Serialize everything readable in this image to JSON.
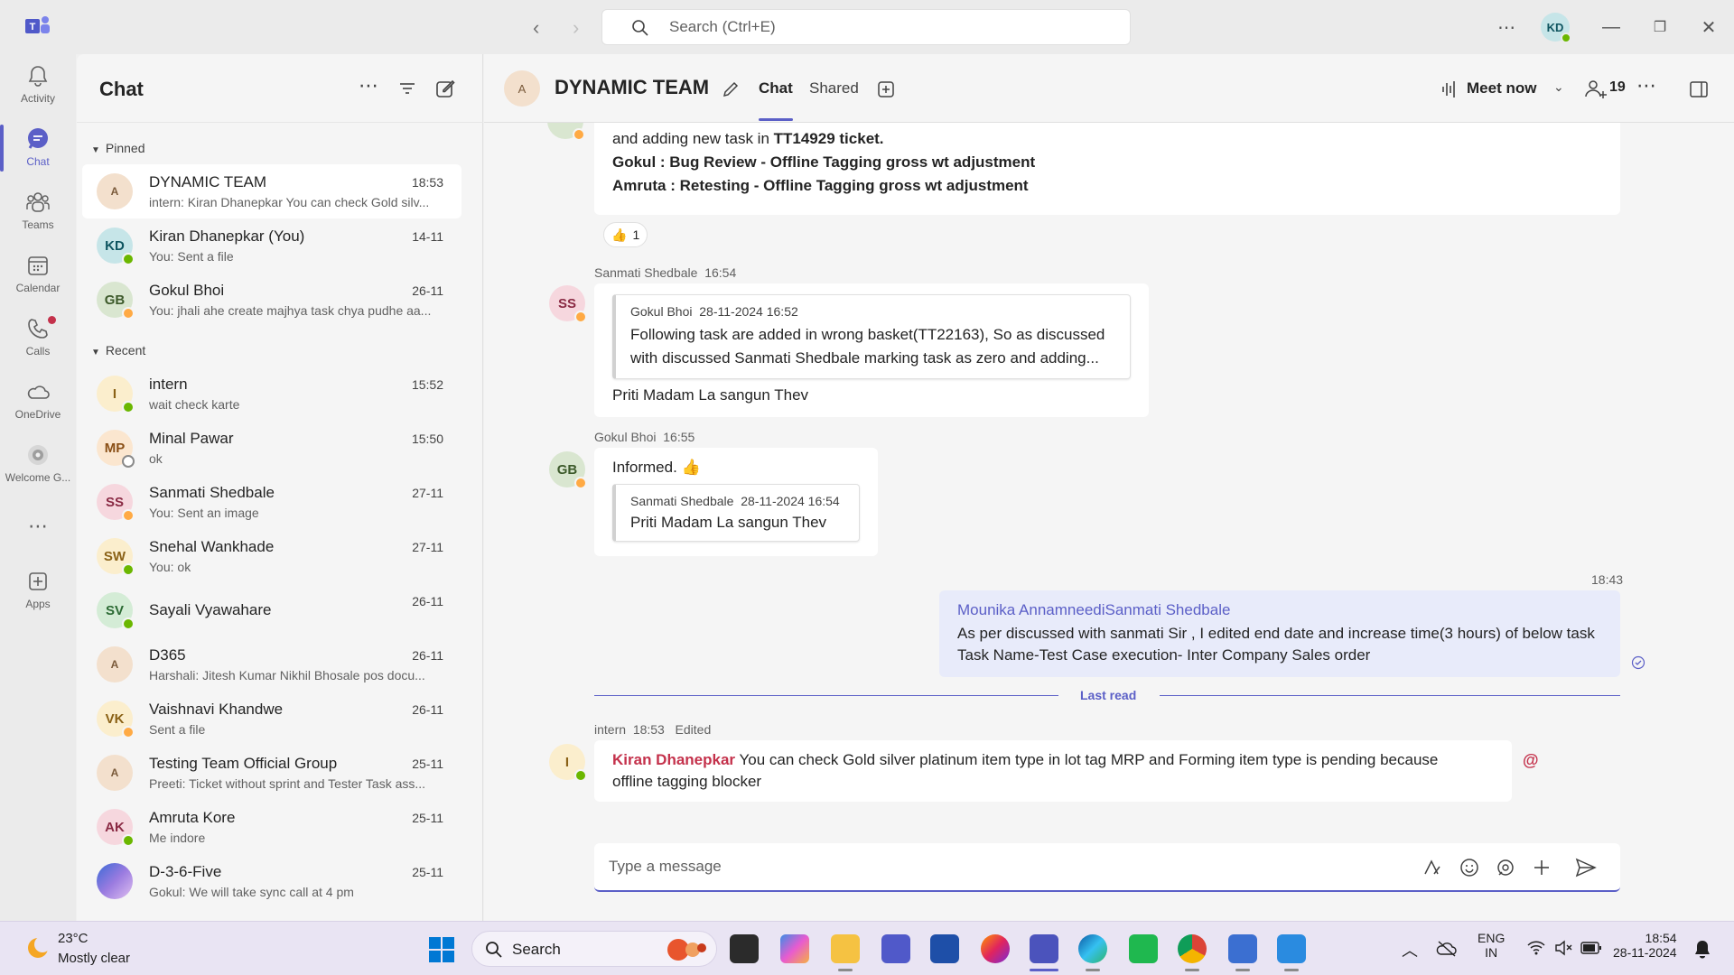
{
  "titlebar": {
    "search_placeholder": "Search (Ctrl+E)",
    "user_initials": "KD"
  },
  "rail": {
    "items": [
      {
        "label": "Activity",
        "icon": "bell-icon"
      },
      {
        "label": "Chat",
        "icon": "chat-icon",
        "active": true
      },
      {
        "label": "Teams",
        "icon": "teams-icon"
      },
      {
        "label": "Calendar",
        "icon": "calendar-icon"
      },
      {
        "label": "Calls",
        "icon": "phone-icon"
      },
      {
        "label": "OneDrive",
        "icon": "cloud-icon"
      },
      {
        "label": "Welcome G...",
        "icon": "welcome-icon"
      },
      {
        "label": "Apps",
        "icon": "apps-icon"
      }
    ]
  },
  "chatlist": {
    "title": "Chat",
    "pinned_label": "Pinned",
    "recent_label": "Recent",
    "pinned": [
      {
        "name": "DYNAMIC TEAM",
        "time": "18:53",
        "preview": "intern: Kiran Dhanepkar You can check Gold silv...",
        "initials": "A",
        "type": "group"
      },
      {
        "name": "Kiran Dhanepkar (You)",
        "time": "14-11",
        "preview": "You: Sent a file",
        "initials": "KD",
        "presence": "green"
      },
      {
        "name": "Gokul Bhoi",
        "time": "26-11",
        "preview": "You: jhali ahe create majhya task chya pudhe aa...",
        "initials": "GB",
        "presence": "yellow"
      }
    ],
    "recent": [
      {
        "name": "intern",
        "time": "15:52",
        "preview": "wait check karte",
        "initials": "I",
        "presence": "green"
      },
      {
        "name": "Minal Pawar",
        "time": "15:50",
        "preview": "ok",
        "initials": "MP",
        "presence": "offline"
      },
      {
        "name": "Sanmati Shedbale",
        "time": "27-11",
        "preview": "You: Sent an image",
        "initials": "SS",
        "presence": "yellow"
      },
      {
        "name": "Snehal Wankhade",
        "time": "27-11",
        "preview": "You: ok",
        "initials": "SW",
        "presence": "green"
      },
      {
        "name": "Sayali Vyawahare",
        "time": "26-11",
        "preview": "",
        "initials": "SV",
        "presence": "green"
      },
      {
        "name": "D365",
        "time": "26-11",
        "preview": "Harshali: Jitesh Kumar Nikhil Bhosale pos docu...",
        "initials": "A",
        "type": "group"
      },
      {
        "name": "Vaishnavi Khandwe",
        "time": "26-11",
        "preview": "Sent a file",
        "initials": "VK",
        "presence": "yellow"
      },
      {
        "name": "Testing Team Official Group",
        "time": "25-11",
        "preview": "Preeti: Ticket without sprint and Tester Task ass...",
        "initials": "A",
        "type": "group"
      },
      {
        "name": "Amruta Kore",
        "time": "25-11",
        "preview": "Me indore",
        "initials": "AK",
        "presence": "green"
      },
      {
        "name": "D-3-6-Five",
        "time": "25-11",
        "preview": "Gokul: We will take sync call at 4 pm",
        "initials": "",
        "type": "image"
      }
    ]
  },
  "header": {
    "team_name": "DYNAMIC TEAM",
    "team_initials": "A",
    "tabs": [
      "Chat",
      "Shared"
    ],
    "meet_now": "Meet now",
    "participant_count": "19"
  },
  "messages": {
    "m1": {
      "line1_pre": "and adding new task in ",
      "line1_bold": "TT14929",
      "line1_post": " ticket.",
      "line2": "Gokul : Bug Review - Offline Tagging gross wt adjustment",
      "line3": "Amruta : Retesting - Offline Tagging gross wt adjustment",
      "reaction_emoji": "👍",
      "reaction_count": "1"
    },
    "m2": {
      "sender": "Sanmati Shedbale",
      "time": "16:54",
      "initials": "SS",
      "quote_author": "Gokul Bhoi",
      "quote_time": "28-11-2024 16:52",
      "quote_line1": "Following task are added in wrong basket(TT22163), So as discussed",
      "quote_line2": "with discussed Sanmati Shedbale marking task as zero and adding...",
      "text": "Priti Madam La sangun Thev"
    },
    "m3": {
      "sender": "Gokul Bhoi",
      "time": "16:55",
      "initials": "GB",
      "text": "Informed. 👍",
      "quote_author": "Sanmati Shedbale",
      "quote_time": "28-11-2024 16:54",
      "quote_text": "Priti Madam La sangun Thev"
    },
    "m4": {
      "time": "18:43",
      "mention": "Mounika AnnamneediSanmati Shedbale",
      "line1": "As per discussed with sanmati Sir , I edited end date and increase time(3 hours) of below task",
      "line2": "Task Name-Test Case execution- Inter Company Sales order"
    },
    "last_read": "Last read",
    "m5": {
      "sender": "intern",
      "time": "18:53",
      "edited": "Edited",
      "initials": "I",
      "mention": "Kiran Dhanepkar",
      "line1": " You can check Gold silver platinum item type in lot tag MRP and Forming item type is pending because",
      "line2": "offline tagging blocker",
      "at_symbol": "@"
    }
  },
  "compose": {
    "placeholder": "Type a message"
  },
  "taskbar": {
    "temp": "23°C",
    "weather": "Mostly clear",
    "search_label": "Search",
    "lang1": "ENG",
    "lang2": "IN",
    "time": "18:54",
    "date": "28-11-2024"
  },
  "colors": {
    "accent": "#5b5fc7",
    "mention": "#c4314b"
  }
}
